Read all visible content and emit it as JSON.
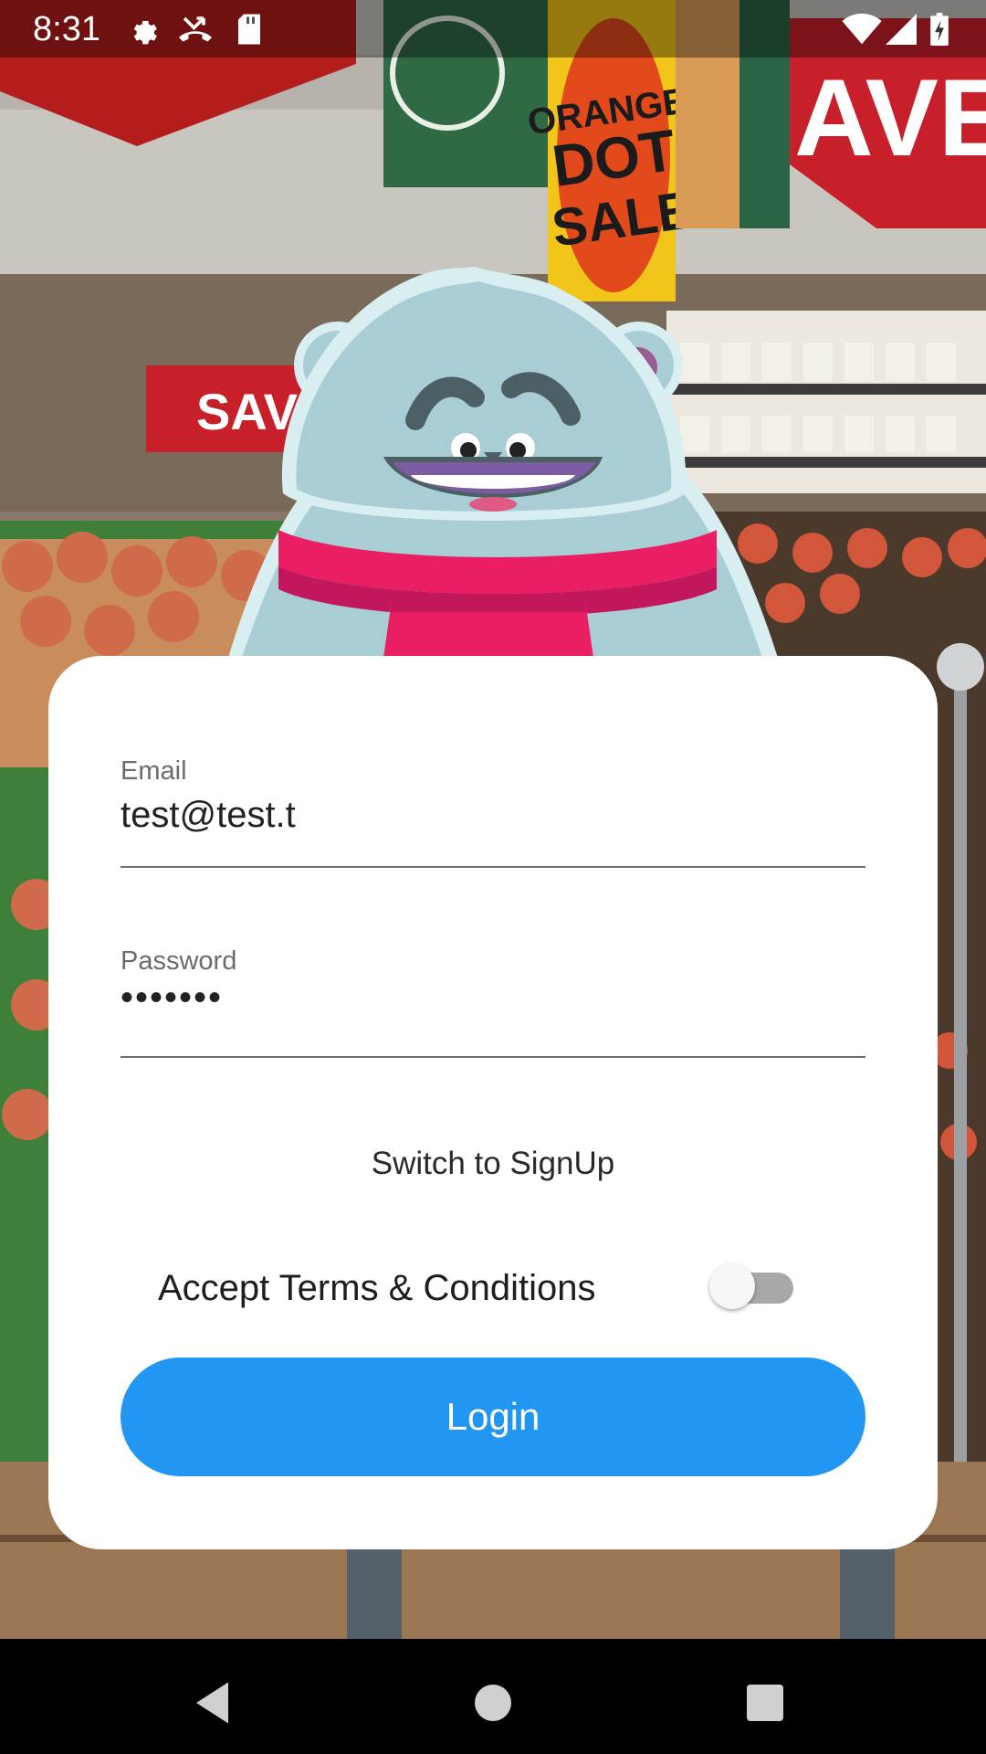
{
  "status_bar": {
    "time": "8:31",
    "left_icons": [
      "settings-icon",
      "missed-call-icon",
      "sd-card-icon"
    ],
    "right_icons": [
      "wifi-icon",
      "cell-signal-icon",
      "battery-icon"
    ]
  },
  "background": {
    "description_icon": "supermarket-background"
  },
  "mascot": {
    "icon": "yeti-mascot"
  },
  "form": {
    "email": {
      "label": "Email",
      "value": "test@test.t"
    },
    "password": {
      "label": "Password",
      "value": "•••••••"
    },
    "switch_label": "Switch to SignUp",
    "terms_label": "Accept Terms & Conditions",
    "terms_accepted": false,
    "login_label": "Login"
  },
  "colors": {
    "primary": "#2196f3",
    "card": "#ffffff",
    "scarf": "#e91e63",
    "mascot_fur": "#a9cdd5"
  },
  "nav_bar": {
    "icons": [
      "back-icon",
      "home-icon",
      "recents-icon"
    ]
  }
}
